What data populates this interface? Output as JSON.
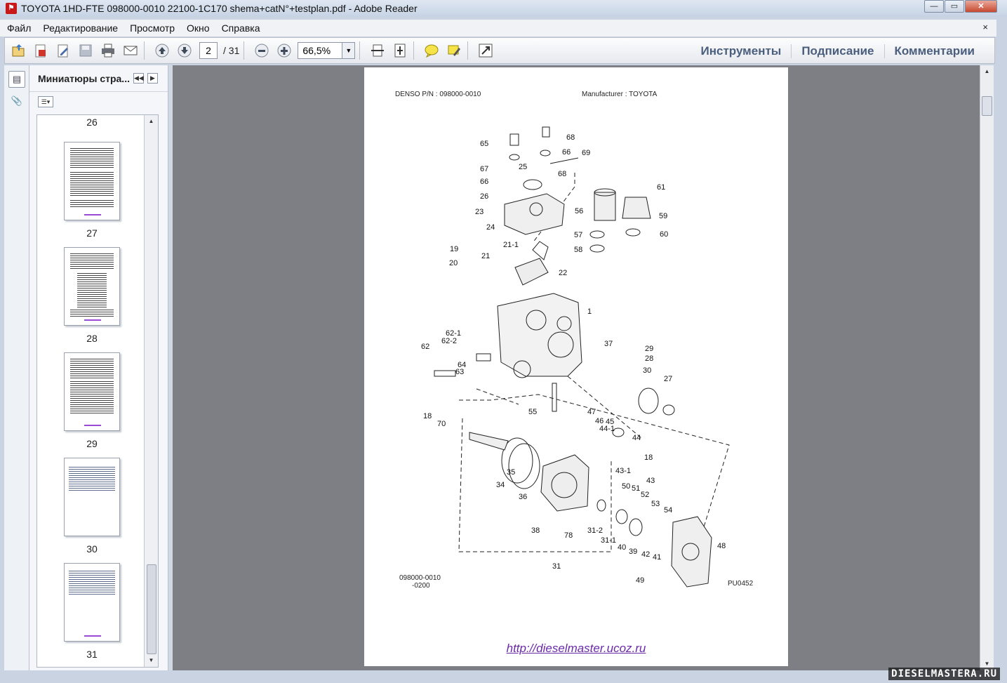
{
  "window": {
    "title": "TOYOTA 1HD-FTE 098000-0010   22100-1C170 shema+catN°+testplan.pdf - Adobe Reader",
    "controls": [
      "minimize",
      "maximize",
      "close"
    ]
  },
  "menu": {
    "items": [
      "Файл",
      "Редактирование",
      "Просмотр",
      "Окно",
      "Справка"
    ],
    "close": "×"
  },
  "toolbar": {
    "current_page": "2",
    "total_pages": "/  31",
    "zoom": "66,5%",
    "links": [
      "Инструменты",
      "Подписание",
      "Комментарии"
    ],
    "icons": [
      "open-icon",
      "create-pdf-icon",
      "edit-icon",
      "save-icon",
      "print-icon",
      "email-icon",
      "prev-page-icon",
      "next-page-icon",
      "zoom-out-icon",
      "zoom-in-icon",
      "fit-width-icon",
      "fit-page-icon",
      "comment-icon",
      "highlight-icon",
      "fullscreen-icon"
    ]
  },
  "sidebar": {
    "title": "Миниатюры стра...",
    "icons": [
      "pages-icon",
      "attachments-icon"
    ]
  },
  "thumbnails": [
    {
      "number": "26"
    },
    {
      "number": "27"
    },
    {
      "number": "28"
    },
    {
      "number": "29"
    },
    {
      "number": "30"
    },
    {
      "number": "31"
    }
  ],
  "document": {
    "header_left": "DENSO P/N : 098000-0010",
    "header_right": "Manufacturer : TOYOTA",
    "code_line1": "098000-0010",
    "code_line2": "-0200",
    "figure_code": "PU0452",
    "url": "http://dieselmaster.ucoz.ru",
    "part_labels": [
      "65",
      "68",
      "66",
      "69",
      "67",
      "25",
      "66",
      "68",
      "26",
      "61",
      "56",
      "59",
      "23",
      "24",
      "57",
      "60",
      "58",
      "19",
      "21-1",
      "21",
      "20",
      "22",
      "1",
      "62-1",
      "62-2",
      "62",
      "37",
      "29",
      "28",
      "64",
      "63",
      "30",
      "27",
      "18",
      "70",
      "47",
      "46",
      "45",
      "55",
      "44-1",
      "44",
      "18",
      "34",
      "35",
      "36",
      "43-1",
      "43",
      "50",
      "51",
      "52",
      "53",
      "54",
      "48",
      "38",
      "78",
      "31-2",
      "31-1",
      "40",
      "39",
      "42",
      "41",
      "31",
      "49"
    ]
  },
  "watermark": "DIESELMASTERA.RU"
}
